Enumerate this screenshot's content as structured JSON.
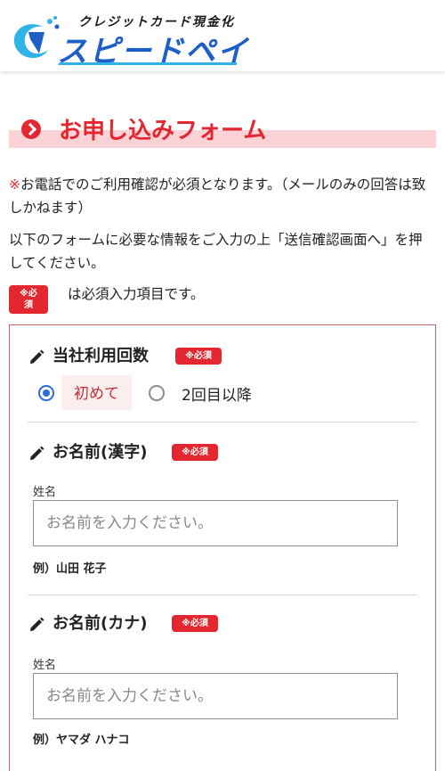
{
  "header": {
    "logo_sub": "クレジットカード現金化",
    "logo_main": "スピードペイ"
  },
  "section": {
    "title": "お申し込みフォーム"
  },
  "notice": {
    "mark": "※",
    "line1": "お電話でのご利用確認が必須となります。（メールのみの回答は致しかねます）",
    "line2": "以下のフォームに必要な情報をご入力の上「送信確認画面へ」を押してください。"
  },
  "legend": {
    "badge": "※必須",
    "text": "は必須入力項目です。"
  },
  "form": {
    "required_badge": "※必須",
    "usage": {
      "label": "当社利用回数",
      "options": [
        "初めて",
        "2回目以降"
      ],
      "selected": "初めて"
    },
    "name_kanji": {
      "label": "お名前(漢字)",
      "sub_label": "姓名",
      "placeholder": "お名前を入力ください。",
      "example": "例）山田 花子"
    },
    "name_kana": {
      "label": "お名前(カナ)",
      "sub_label": "姓名",
      "placeholder": "お名前を入力ください。",
      "example": "例）ヤマダ ハナコ"
    }
  },
  "colors": {
    "accent_red": "#e3262f",
    "brand_blue": "#1d5fc7",
    "radio_blue": "#2a6bdc"
  }
}
